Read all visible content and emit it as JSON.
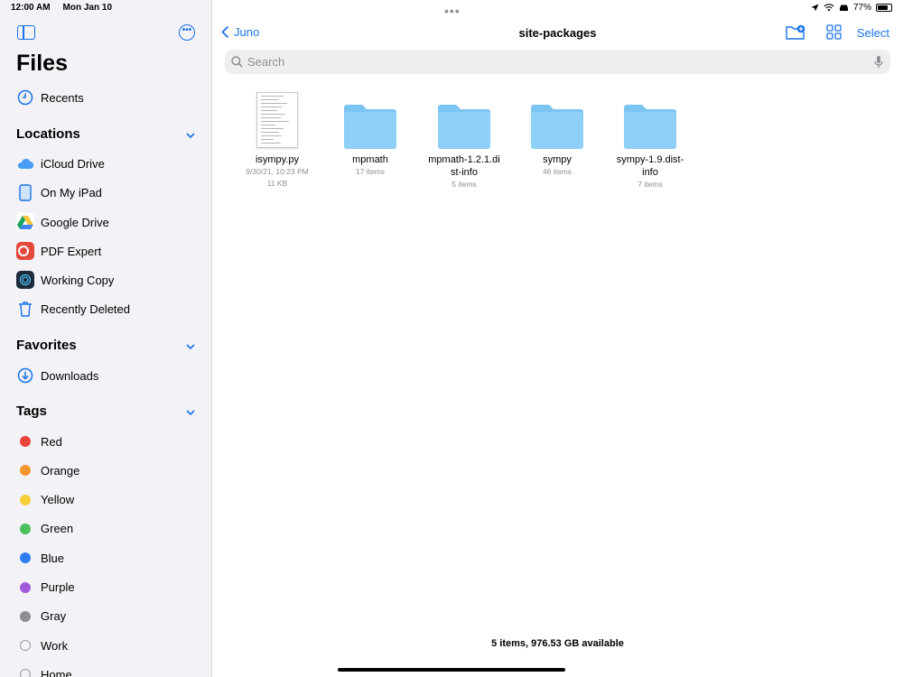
{
  "status": {
    "time": "12:00 AM",
    "date": "Mon Jan 10",
    "battery": "77%",
    "battery_level": 0.77
  },
  "sidebar": {
    "title": "Files",
    "recents": "Recents",
    "locations_header": "Locations",
    "locations": [
      {
        "label": "iCloud Drive",
        "icon": "icloud-icon"
      },
      {
        "label": "On My iPad",
        "icon": "ipad-icon"
      },
      {
        "label": "Google Drive",
        "icon": "google-drive-icon"
      },
      {
        "label": "PDF Expert",
        "icon": "pdf-expert-icon"
      },
      {
        "label": "Working Copy",
        "icon": "working-copy-icon"
      },
      {
        "label": "Recently Deleted",
        "icon": "trash-icon"
      }
    ],
    "favorites_header": "Favorites",
    "favorites": [
      {
        "label": "Downloads",
        "icon": "download-icon"
      }
    ],
    "tags_header": "Tags",
    "tags": [
      {
        "label": "Red",
        "color": "#e8453c"
      },
      {
        "label": "Orange",
        "color": "#f3962f"
      },
      {
        "label": "Yellow",
        "color": "#f7cf3b"
      },
      {
        "label": "Green",
        "color": "#4cc05a"
      },
      {
        "label": "Blue",
        "color": "#2f7ef1"
      },
      {
        "label": "Purple",
        "color": "#a35ad9"
      },
      {
        "label": "Gray",
        "color": "#8e8e93"
      },
      {
        "label": "Work",
        "color": ""
      },
      {
        "label": "Home",
        "color": ""
      }
    ]
  },
  "toolbar": {
    "back_label": "Juno",
    "title": "site-packages",
    "select_label": "Select"
  },
  "search": {
    "placeholder": "Search"
  },
  "items": [
    {
      "name_line1": "isympy.py",
      "name_line2": "",
      "meta1": "9/30/21, 10:23 PM",
      "meta2": "11 KB",
      "kind": "document"
    },
    {
      "name_line1": "mpmath",
      "name_line2": "",
      "meta1": "17 items",
      "meta2": "",
      "kind": "folder"
    },
    {
      "name_line1": "mpmath-1.2.1.di",
      "name_line2": "st-info",
      "meta1": "5 items",
      "meta2": "",
      "kind": "folder"
    },
    {
      "name_line1": "sympy",
      "name_line2": "",
      "meta1": "46 items",
      "meta2": "",
      "kind": "folder"
    },
    {
      "name_line1": "sympy-1.9.dist-",
      "name_line2": "info",
      "meta1": "7 items",
      "meta2": "",
      "kind": "folder"
    }
  ],
  "footer": {
    "status": "5 items, 976.53 GB available"
  },
  "colors": {
    "accent": "#1a73e8",
    "folder": "#8fd0f8",
    "sidebar_bg": "#f2f2f7"
  }
}
